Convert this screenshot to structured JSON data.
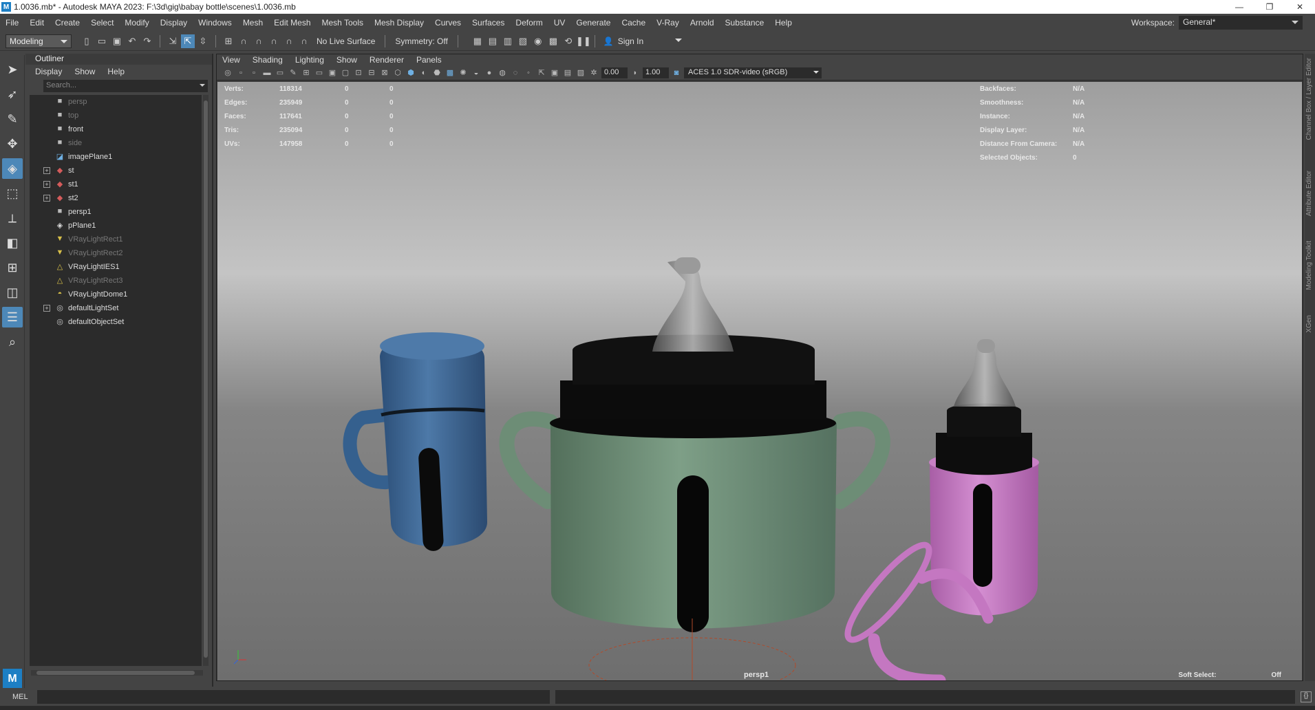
{
  "titlebar": {
    "logo": "M",
    "title": "1.0036.mb* - Autodesk MAYA 2023: F:\\3d\\gig\\babay bottle\\scenes\\1.0036.mb",
    "minimize": "—",
    "restore": "❐",
    "close": "✕"
  },
  "menubar": {
    "items": [
      "File",
      "Edit",
      "Create",
      "Select",
      "Modify",
      "Display",
      "Windows",
      "Mesh",
      "Edit Mesh",
      "Mesh Tools",
      "Mesh Display",
      "Curves",
      "Surfaces",
      "Deform",
      "UV",
      "Generate",
      "Cache",
      "V-Ray",
      "Arnold",
      "Substance",
      "Help"
    ],
    "workspace_label": "Workspace:",
    "workspace_value": "General*"
  },
  "shelf": {
    "mode": "Modeling",
    "live_surface": "No Live Surface",
    "symmetry": "Symmetry: Off",
    "sign_in": "Sign In"
  },
  "outliner": {
    "title": "Outliner",
    "menu": [
      "Display",
      "Show",
      "Help"
    ],
    "search_placeholder": "Search...",
    "items": [
      {
        "label": "persp",
        "icon": "camera-icon",
        "dim": true,
        "expandable": false
      },
      {
        "label": "top",
        "icon": "camera-icon",
        "dim": true,
        "expandable": false
      },
      {
        "label": "front",
        "icon": "camera-icon",
        "dim": false,
        "expandable": false
      },
      {
        "label": "side",
        "icon": "camera-icon",
        "dim": true,
        "expandable": false
      },
      {
        "label": "imagePlane1",
        "icon": "image-plane-icon",
        "dim": false,
        "expandable": false
      },
      {
        "label": "st",
        "icon": "mesh-icon",
        "dim": false,
        "expandable": true
      },
      {
        "label": "st1",
        "icon": "mesh-icon",
        "dim": false,
        "expandable": true
      },
      {
        "label": "st2",
        "icon": "mesh-icon",
        "dim": false,
        "expandable": true
      },
      {
        "label": "persp1",
        "icon": "camera-icon",
        "dim": false,
        "expandable": false
      },
      {
        "label": "pPlane1",
        "icon": "plane-icon",
        "dim": false,
        "expandable": false
      },
      {
        "label": "VRayLightRect1",
        "icon": "light-rect-icon",
        "dim": true,
        "expandable": false
      },
      {
        "label": "VRayLightRect2",
        "icon": "light-rect-icon",
        "dim": true,
        "expandable": false
      },
      {
        "label": "VRayLightIES1",
        "icon": "light-ies-icon",
        "dim": false,
        "expandable": false
      },
      {
        "label": "VRayLightRect3",
        "icon": "light-ies-icon",
        "dim": true,
        "expandable": false
      },
      {
        "label": "VRayLightDome1",
        "icon": "light-dome-icon",
        "dim": false,
        "expandable": false
      },
      {
        "label": "defaultLightSet",
        "icon": "set-icon",
        "dim": false,
        "expandable": true
      },
      {
        "label": "defaultObjectSet",
        "icon": "set-icon",
        "dim": false,
        "expandable": false
      }
    ]
  },
  "viewport": {
    "menu": [
      "View",
      "Shading",
      "Lighting",
      "Show",
      "Renderer",
      "Panels"
    ],
    "exposure": "0.00",
    "gamma": "1.00",
    "color_space": "ACES 1.0 SDR-video (sRGB)",
    "camera": "persp1",
    "hud_left": [
      {
        "k": "Verts:",
        "v": "118314",
        "a": "0",
        "b": "0"
      },
      {
        "k": "Edges:",
        "v": "235949",
        "a": "0",
        "b": "0"
      },
      {
        "k": "Faces:",
        "v": "117641",
        "a": "0",
        "b": "0"
      },
      {
        "k": "Tris:",
        "v": "235094",
        "a": "0",
        "b": "0"
      },
      {
        "k": "UVs:",
        "v": "147958",
        "a": "0",
        "b": "0"
      }
    ],
    "hud_right": [
      {
        "k": "Backfaces:",
        "v": "N/A"
      },
      {
        "k": "Smoothness:",
        "v": "N/A"
      },
      {
        "k": "Instance:",
        "v": "N/A"
      },
      {
        "k": "Display Layer:",
        "v": "N/A"
      },
      {
        "k": "Distance From Camera:",
        "v": "N/A"
      },
      {
        "k": "Selected Objects:",
        "v": "0"
      }
    ],
    "soft_select_label": "Soft Select:",
    "soft_select_value": "Off",
    "colors": {
      "blue_cup": "#3e6a9a",
      "green_cup": "#6f8f78",
      "pink_cup": "#c77cc4",
      "floor": "#7a7a7a",
      "sky": "#b5b5b5"
    }
  },
  "right_tabs": [
    "Channel Box / Layer Editor",
    "Attribute Editor",
    "Modeling Toolkit",
    "XGen"
  ],
  "cmdline": {
    "label": "MEL"
  }
}
